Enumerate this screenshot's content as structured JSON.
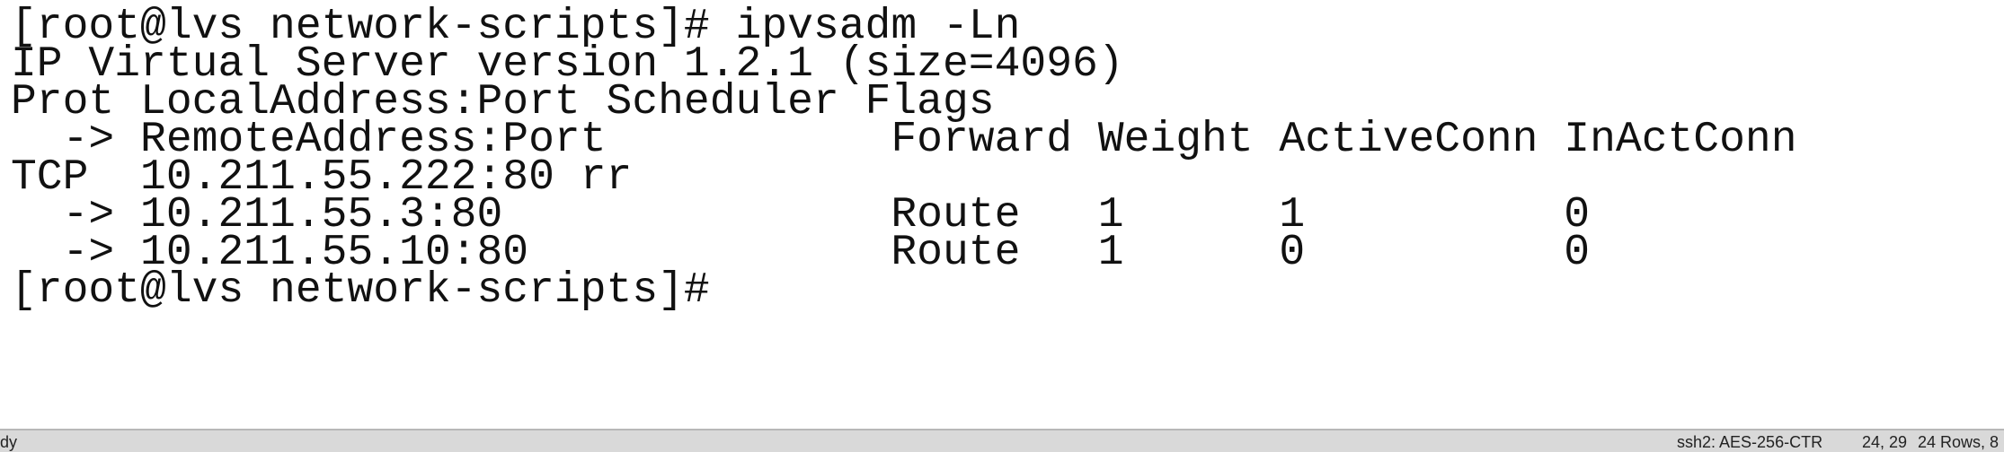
{
  "terminal": {
    "lines": [
      "[root@lvs network-scripts]# ipvsadm -Ln",
      "IP Virtual Server version 1.2.1 (size=4096)",
      "Prot LocalAddress:Port Scheduler Flags",
      "  -> RemoteAddress:Port           Forward Weight ActiveConn InActConn",
      "TCP  10.211.55.222:80 rr",
      "  -> 10.211.55.3:80               Route   1      1          0",
      "  -> 10.211.55.10:80              Route   1      0          0",
      "[root@lvs network-scripts]#"
    ]
  },
  "statusbar": {
    "left_text": "dy",
    "cipher": "ssh2: AES-256-CTR",
    "cursor_pos": "24, 29",
    "size": "24 Rows, 8"
  },
  "colors": {
    "background": "#ffffff",
    "text": "#111111",
    "statusbar_bg": "#d9d9d9"
  }
}
